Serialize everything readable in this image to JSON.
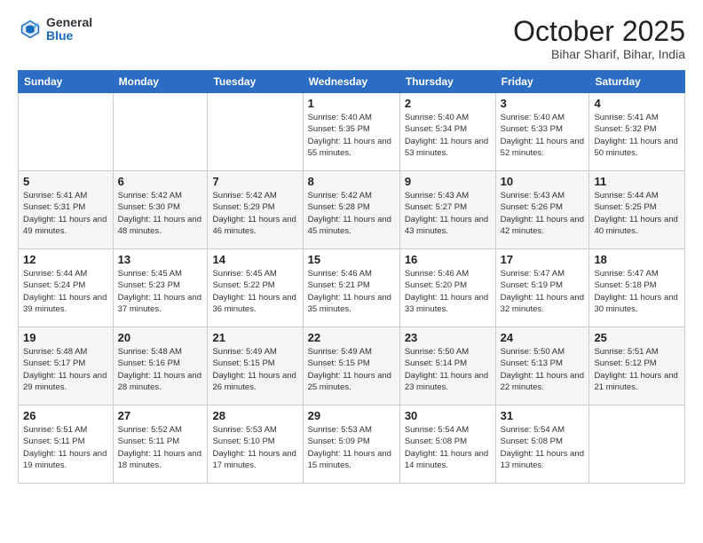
{
  "header": {
    "logo_general": "General",
    "logo_blue": "Blue",
    "month_title": "October 2025",
    "location": "Bihar Sharif, Bihar, India"
  },
  "weekdays": [
    "Sunday",
    "Monday",
    "Tuesday",
    "Wednesday",
    "Thursday",
    "Friday",
    "Saturday"
  ],
  "weeks": [
    [
      {
        "day": "",
        "sunrise": "",
        "sunset": "",
        "daylight": ""
      },
      {
        "day": "",
        "sunrise": "",
        "sunset": "",
        "daylight": ""
      },
      {
        "day": "",
        "sunrise": "",
        "sunset": "",
        "daylight": ""
      },
      {
        "day": "1",
        "sunrise": "Sunrise: 5:40 AM",
        "sunset": "Sunset: 5:35 PM",
        "daylight": "Daylight: 11 hours and 55 minutes."
      },
      {
        "day": "2",
        "sunrise": "Sunrise: 5:40 AM",
        "sunset": "Sunset: 5:34 PM",
        "daylight": "Daylight: 11 hours and 53 minutes."
      },
      {
        "day": "3",
        "sunrise": "Sunrise: 5:40 AM",
        "sunset": "Sunset: 5:33 PM",
        "daylight": "Daylight: 11 hours and 52 minutes."
      },
      {
        "day": "4",
        "sunrise": "Sunrise: 5:41 AM",
        "sunset": "Sunset: 5:32 PM",
        "daylight": "Daylight: 11 hours and 50 minutes."
      }
    ],
    [
      {
        "day": "5",
        "sunrise": "Sunrise: 5:41 AM",
        "sunset": "Sunset: 5:31 PM",
        "daylight": "Daylight: 11 hours and 49 minutes."
      },
      {
        "day": "6",
        "sunrise": "Sunrise: 5:42 AM",
        "sunset": "Sunset: 5:30 PM",
        "daylight": "Daylight: 11 hours and 48 minutes."
      },
      {
        "day": "7",
        "sunrise": "Sunrise: 5:42 AM",
        "sunset": "Sunset: 5:29 PM",
        "daylight": "Daylight: 11 hours and 46 minutes."
      },
      {
        "day": "8",
        "sunrise": "Sunrise: 5:42 AM",
        "sunset": "Sunset: 5:28 PM",
        "daylight": "Daylight: 11 hours and 45 minutes."
      },
      {
        "day": "9",
        "sunrise": "Sunrise: 5:43 AM",
        "sunset": "Sunset: 5:27 PM",
        "daylight": "Daylight: 11 hours and 43 minutes."
      },
      {
        "day": "10",
        "sunrise": "Sunrise: 5:43 AM",
        "sunset": "Sunset: 5:26 PM",
        "daylight": "Daylight: 11 hours and 42 minutes."
      },
      {
        "day": "11",
        "sunrise": "Sunrise: 5:44 AM",
        "sunset": "Sunset: 5:25 PM",
        "daylight": "Daylight: 11 hours and 40 minutes."
      }
    ],
    [
      {
        "day": "12",
        "sunrise": "Sunrise: 5:44 AM",
        "sunset": "Sunset: 5:24 PM",
        "daylight": "Daylight: 11 hours and 39 minutes."
      },
      {
        "day": "13",
        "sunrise": "Sunrise: 5:45 AM",
        "sunset": "Sunset: 5:23 PM",
        "daylight": "Daylight: 11 hours and 37 minutes."
      },
      {
        "day": "14",
        "sunrise": "Sunrise: 5:45 AM",
        "sunset": "Sunset: 5:22 PM",
        "daylight": "Daylight: 11 hours and 36 minutes."
      },
      {
        "day": "15",
        "sunrise": "Sunrise: 5:46 AM",
        "sunset": "Sunset: 5:21 PM",
        "daylight": "Daylight: 11 hours and 35 minutes."
      },
      {
        "day": "16",
        "sunrise": "Sunrise: 5:46 AM",
        "sunset": "Sunset: 5:20 PM",
        "daylight": "Daylight: 11 hours and 33 minutes."
      },
      {
        "day": "17",
        "sunrise": "Sunrise: 5:47 AM",
        "sunset": "Sunset: 5:19 PM",
        "daylight": "Daylight: 11 hours and 32 minutes."
      },
      {
        "day": "18",
        "sunrise": "Sunrise: 5:47 AM",
        "sunset": "Sunset: 5:18 PM",
        "daylight": "Daylight: 11 hours and 30 minutes."
      }
    ],
    [
      {
        "day": "19",
        "sunrise": "Sunrise: 5:48 AM",
        "sunset": "Sunset: 5:17 PM",
        "daylight": "Daylight: 11 hours and 29 minutes."
      },
      {
        "day": "20",
        "sunrise": "Sunrise: 5:48 AM",
        "sunset": "Sunset: 5:16 PM",
        "daylight": "Daylight: 11 hours and 28 minutes."
      },
      {
        "day": "21",
        "sunrise": "Sunrise: 5:49 AM",
        "sunset": "Sunset: 5:15 PM",
        "daylight": "Daylight: 11 hours and 26 minutes."
      },
      {
        "day": "22",
        "sunrise": "Sunrise: 5:49 AM",
        "sunset": "Sunset: 5:15 PM",
        "daylight": "Daylight: 11 hours and 25 minutes."
      },
      {
        "day": "23",
        "sunrise": "Sunrise: 5:50 AM",
        "sunset": "Sunset: 5:14 PM",
        "daylight": "Daylight: 11 hours and 23 minutes."
      },
      {
        "day": "24",
        "sunrise": "Sunrise: 5:50 AM",
        "sunset": "Sunset: 5:13 PM",
        "daylight": "Daylight: 11 hours and 22 minutes."
      },
      {
        "day": "25",
        "sunrise": "Sunrise: 5:51 AM",
        "sunset": "Sunset: 5:12 PM",
        "daylight": "Daylight: 11 hours and 21 minutes."
      }
    ],
    [
      {
        "day": "26",
        "sunrise": "Sunrise: 5:51 AM",
        "sunset": "Sunset: 5:11 PM",
        "daylight": "Daylight: 11 hours and 19 minutes."
      },
      {
        "day": "27",
        "sunrise": "Sunrise: 5:52 AM",
        "sunset": "Sunset: 5:11 PM",
        "daylight": "Daylight: 11 hours and 18 minutes."
      },
      {
        "day": "28",
        "sunrise": "Sunrise: 5:53 AM",
        "sunset": "Sunset: 5:10 PM",
        "daylight": "Daylight: 11 hours and 17 minutes."
      },
      {
        "day": "29",
        "sunrise": "Sunrise: 5:53 AM",
        "sunset": "Sunset: 5:09 PM",
        "daylight": "Daylight: 11 hours and 15 minutes."
      },
      {
        "day": "30",
        "sunrise": "Sunrise: 5:54 AM",
        "sunset": "Sunset: 5:08 PM",
        "daylight": "Daylight: 11 hours and 14 minutes."
      },
      {
        "day": "31",
        "sunrise": "Sunrise: 5:54 AM",
        "sunset": "Sunset: 5:08 PM",
        "daylight": "Daylight: 11 hours and 13 minutes."
      },
      {
        "day": "",
        "sunrise": "",
        "sunset": "",
        "daylight": ""
      }
    ]
  ]
}
